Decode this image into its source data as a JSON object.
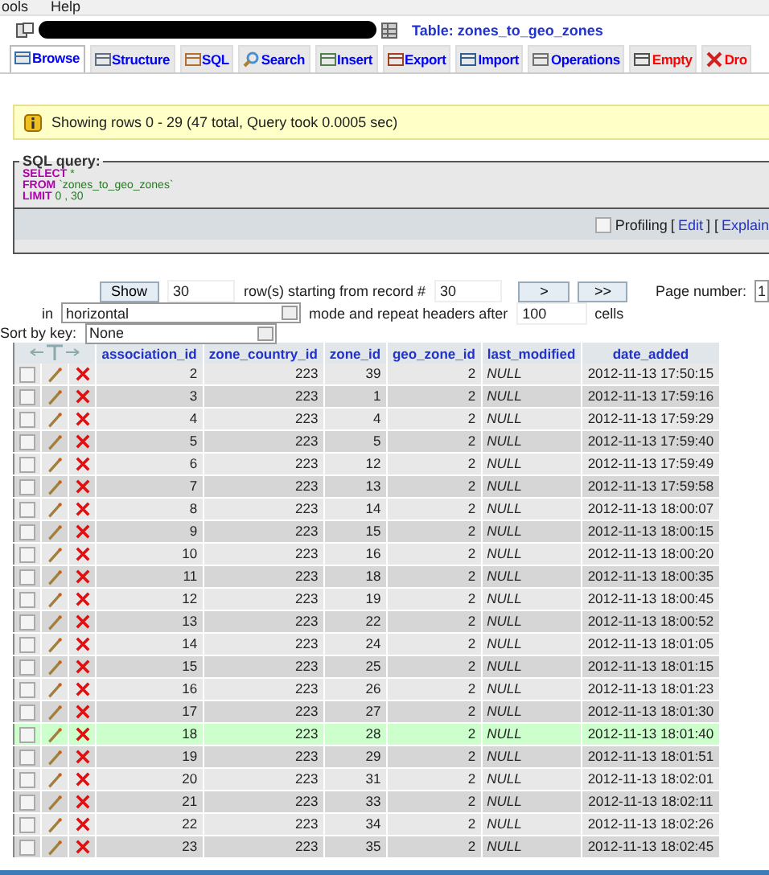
{
  "menu_bar": {
    "items": [
      "ools",
      "Help"
    ]
  },
  "header": {
    "title": "Table: zones_to_geo_zones"
  },
  "tabs": [
    {
      "label": "Browse",
      "selected": true,
      "kind": "browse"
    },
    {
      "label": "Structure",
      "selected": false,
      "kind": "structure"
    },
    {
      "label": "SQL",
      "selected": false,
      "kind": "sql"
    },
    {
      "label": "Search",
      "selected": false,
      "kind": "search"
    },
    {
      "label": "Insert",
      "selected": false,
      "kind": "insert"
    },
    {
      "label": "Export",
      "selected": false,
      "kind": "export"
    },
    {
      "label": "Import",
      "selected": false,
      "kind": "import"
    },
    {
      "label": "Operations",
      "selected": false,
      "kind": "operations"
    },
    {
      "label": "Empty",
      "selected": false,
      "kind": "empty"
    },
    {
      "label": "Dro",
      "selected": false,
      "kind": "drop"
    }
  ],
  "notice": "Showing rows 0 - 29 (47 total, Query took 0.0005 sec)",
  "sql_query": {
    "legend": "SQL query:",
    "lines": [
      {
        "keyword": "SELECT",
        "rest": "*"
      },
      {
        "keyword": "FROM",
        "rest": "`zones_to_geo_zones`"
      },
      {
        "keyword": "LIMIT",
        "rest": "0 , 30"
      }
    ],
    "profiling": {
      "label": "Profiling",
      "checked": false
    },
    "links": [
      "[",
      "Edit",
      "] [",
      "Explain"
    ]
  },
  "navigation": {
    "show_button": "Show",
    "rows": "30",
    "starting_label": "row(s) starting from record #",
    "start": "30",
    "next": ">",
    "last": ">>",
    "page_label": "Page number:",
    "page": "1",
    "in_label": "in",
    "mode": "horizontal",
    "mode_label": "mode and repeat headers after",
    "repeat": "100",
    "cells_label": "cells",
    "sort_label": "Sort by key:",
    "sort": "None"
  },
  "table": {
    "columns": [
      "association_id",
      "zone_country_id",
      "zone_id",
      "geo_zone_id",
      "last_modified",
      "date_added"
    ],
    "rows": [
      {
        "cells": [
          "2",
          "223",
          "39",
          "2",
          "NULL",
          "2012-11-13 17:50:15"
        ],
        "checked": false,
        "highlighted": false
      },
      {
        "cells": [
          "3",
          "223",
          "1",
          "2",
          "NULL",
          "2012-11-13 17:59:16"
        ],
        "checked": false,
        "highlighted": false
      },
      {
        "cells": [
          "4",
          "223",
          "4",
          "2",
          "NULL",
          "2012-11-13 17:59:29"
        ],
        "checked": false,
        "highlighted": false
      },
      {
        "cells": [
          "5",
          "223",
          "5",
          "2",
          "NULL",
          "2012-11-13 17:59:40"
        ],
        "checked": false,
        "highlighted": false
      },
      {
        "cells": [
          "6",
          "223",
          "12",
          "2",
          "NULL",
          "2012-11-13 17:59:49"
        ],
        "checked": false,
        "highlighted": false
      },
      {
        "cells": [
          "7",
          "223",
          "13",
          "2",
          "NULL",
          "2012-11-13 17:59:58"
        ],
        "checked": false,
        "highlighted": false
      },
      {
        "cells": [
          "8",
          "223",
          "14",
          "2",
          "NULL",
          "2012-11-13 18:00:07"
        ],
        "checked": false,
        "highlighted": false
      },
      {
        "cells": [
          "9",
          "223",
          "15",
          "2",
          "NULL",
          "2012-11-13 18:00:15"
        ],
        "checked": false,
        "highlighted": false
      },
      {
        "cells": [
          "10",
          "223",
          "16",
          "2",
          "NULL",
          "2012-11-13 18:00:20"
        ],
        "checked": false,
        "highlighted": false
      },
      {
        "cells": [
          "11",
          "223",
          "18",
          "2",
          "NULL",
          "2012-11-13 18:00:35"
        ],
        "checked": false,
        "highlighted": false
      },
      {
        "cells": [
          "12",
          "223",
          "19",
          "2",
          "NULL",
          "2012-11-13 18:00:45"
        ],
        "checked": false,
        "highlighted": false
      },
      {
        "cells": [
          "13",
          "223",
          "22",
          "2",
          "NULL",
          "2012-11-13 18:00:52"
        ],
        "checked": false,
        "highlighted": false
      },
      {
        "cells": [
          "14",
          "223",
          "24",
          "2",
          "NULL",
          "2012-11-13 18:01:05"
        ],
        "checked": false,
        "highlighted": false
      },
      {
        "cells": [
          "15",
          "223",
          "25",
          "2",
          "NULL",
          "2012-11-13 18:01:15"
        ],
        "checked": false,
        "highlighted": false
      },
      {
        "cells": [
          "16",
          "223",
          "26",
          "2",
          "NULL",
          "2012-11-13 18:01:23"
        ],
        "checked": false,
        "highlighted": false
      },
      {
        "cells": [
          "17",
          "223",
          "27",
          "2",
          "NULL",
          "2012-11-13 18:01:30"
        ],
        "checked": false,
        "highlighted": false
      },
      {
        "cells": [
          "18",
          "223",
          "28",
          "2",
          "NULL",
          "2012-11-13 18:01:40"
        ],
        "checked": false,
        "highlighted": true
      },
      {
        "cells": [
          "19",
          "223",
          "29",
          "2",
          "NULL",
          "2012-11-13 18:01:51"
        ],
        "checked": false,
        "highlighted": false
      },
      {
        "cells": [
          "20",
          "223",
          "31",
          "2",
          "NULL",
          "2012-11-13 18:02:01"
        ],
        "checked": false,
        "highlighted": false
      },
      {
        "cells": [
          "21",
          "223",
          "33",
          "2",
          "NULL",
          "2012-11-13 18:02:11"
        ],
        "checked": false,
        "highlighted": false
      },
      {
        "cells": [
          "22",
          "223",
          "34",
          "2",
          "NULL",
          "2012-11-13 18:02:26"
        ],
        "checked": false,
        "highlighted": false
      },
      {
        "cells": [
          "23",
          "223",
          "35",
          "2",
          "NULL",
          "2012-11-13 18:02:45"
        ],
        "checked": false,
        "highlighted": false
      }
    ]
  }
}
